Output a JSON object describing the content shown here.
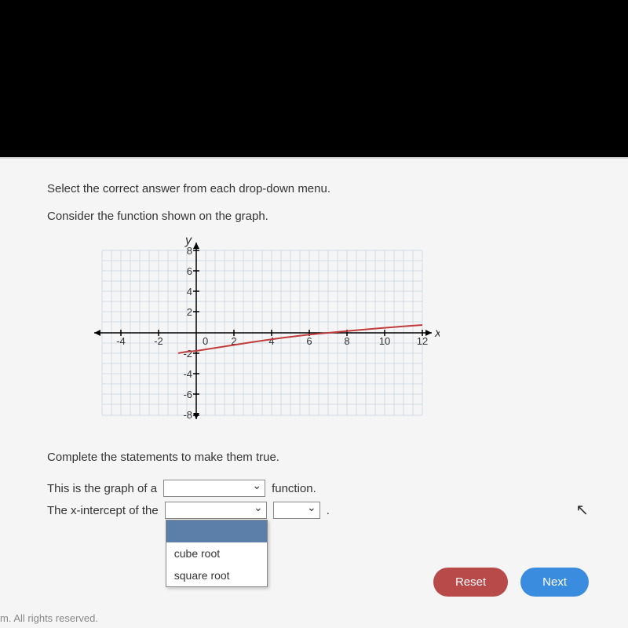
{
  "instruction": "Select the correct answer from each drop-down menu.",
  "subtext": "Consider the function shown on the graph.",
  "complete": "Complete the statements to make them true.",
  "statement1": {
    "pre": "This is the graph of a",
    "post": "function."
  },
  "statement2": {
    "pre": "The x-intercept of the"
  },
  "dropdown_options": {
    "opt1": "cube root",
    "opt2": "square root"
  },
  "buttons": {
    "reset": "Reset",
    "next": "Next"
  },
  "footer": "m. All rights reserved.",
  "chart_data": {
    "type": "line",
    "title": "",
    "xlabel": "x",
    "ylabel": "y",
    "xlim": [
      -5,
      13
    ],
    "ylim": [
      -8,
      8
    ],
    "x_ticks": [
      -4,
      -2,
      0,
      2,
      4,
      6,
      8,
      10,
      12
    ],
    "y_ticks": [
      -8,
      -6,
      -4,
      -2,
      2,
      4,
      6,
      8
    ],
    "series": [
      {
        "name": "function",
        "color": "#c23b3b",
        "points": [
          {
            "x": -1,
            "y": -2
          },
          {
            "x": 0,
            "y": -1.75
          },
          {
            "x": 1,
            "y": -1.5
          },
          {
            "x": 3,
            "y": -1
          },
          {
            "x": 7,
            "y": 0
          },
          {
            "x": 10,
            "y": 0.5
          },
          {
            "x": 12,
            "y": 0.8
          }
        ]
      }
    ]
  }
}
